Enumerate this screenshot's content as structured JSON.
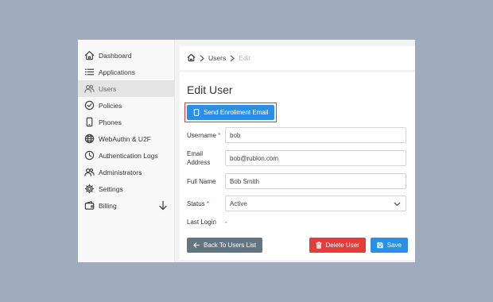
{
  "sidebar": {
    "items": [
      {
        "label": "Dashboard",
        "icon": "home-icon"
      },
      {
        "label": "Applications",
        "icon": "list-icon"
      },
      {
        "label": "Users",
        "icon": "users-icon"
      },
      {
        "label": "Policies",
        "icon": "check-circle-icon"
      },
      {
        "label": "Phones",
        "icon": "phone-icon"
      },
      {
        "label": "WebAuthn & U2F",
        "icon": "globe-icon"
      },
      {
        "label": "Authentication Logs",
        "icon": "clock-icon"
      },
      {
        "label": "Administrators",
        "icon": "admin-users-icon"
      },
      {
        "label": "Settings",
        "icon": "gear-icon"
      },
      {
        "label": "Billing",
        "icon": "wallet-icon"
      }
    ],
    "active": "Users"
  },
  "breadcrumb": {
    "items": [
      "Users",
      "Edit"
    ]
  },
  "page": {
    "title": "Edit User",
    "enroll_button": "Send Enrollment Email"
  },
  "form": {
    "username_label": "Username",
    "username_value": "bob",
    "email_label_1": "Email",
    "email_label_2": "Address",
    "email_value": "bob@rublon.com",
    "fullname_label": "Full Name",
    "fullname_value": "Bob Smith",
    "status_label": "Status",
    "status_value": "Active",
    "lastlogin_label": "Last Login",
    "lastlogin_value": "-",
    "required_mark": "*"
  },
  "actions": {
    "back": "Back To Users List",
    "delete": "Delete User",
    "save": "Save"
  },
  "colors": {
    "accent_blue": "#2b8fe8",
    "danger_red": "#e43b3b",
    "back_gray": "#627682",
    "highlight_border": "#e53935"
  }
}
